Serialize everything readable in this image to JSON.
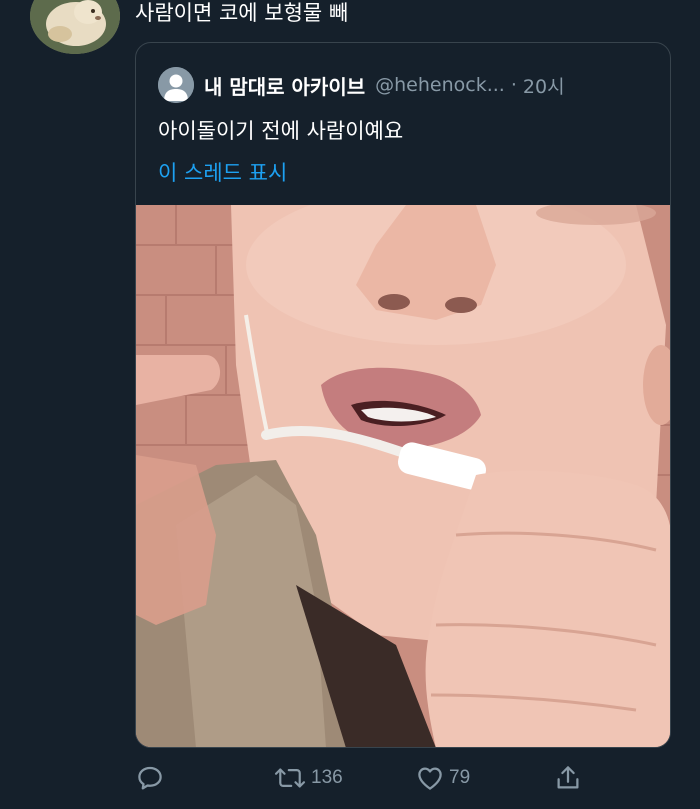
{
  "tweet": {
    "text": "사람이면 코에 보형물 빼"
  },
  "quote": {
    "name": "내 맘대로 아카이브",
    "handle": "@hehenock...",
    "separator": "·",
    "time": "20시",
    "text": "아이돌이기 전에 사람이예요",
    "thread_link": "이 스레드 표시"
  },
  "actions": {
    "reply_icon": "reply-icon",
    "retweet_icon": "retweet-icon",
    "retweet_count": "136",
    "like_icon": "heart-icon",
    "like_count": "79",
    "share_icon": "share-icon"
  },
  "colors": {
    "background": "#15202b",
    "text_primary": "#ffffff",
    "text_secondary": "#8899a6",
    "link": "#1da1f2",
    "border": "#38444d"
  }
}
